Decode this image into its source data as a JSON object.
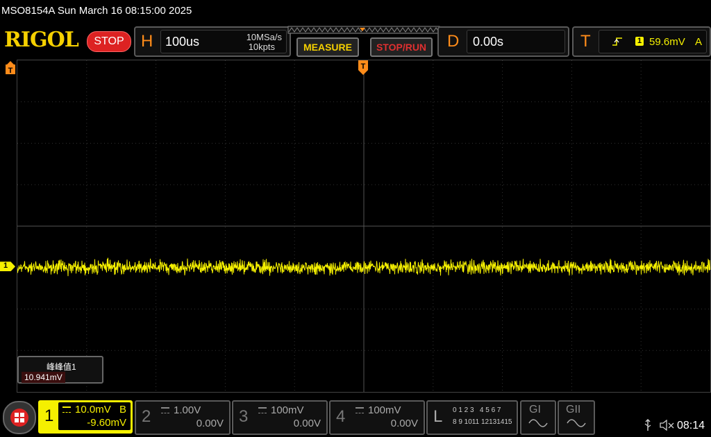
{
  "title_bar": {
    "text": "MSO8154A  Sun March 16 08:15:00 2025"
  },
  "header": {
    "logo": "RIGOL",
    "run_state": "STOP",
    "horizontal": {
      "letter": "H",
      "timebase": "100us",
      "sample_rate": "10MSa/s",
      "memory_depth": "10kpts"
    },
    "measure_label": "MEASURE",
    "stop_run_label": "STOP/RUN",
    "delay": {
      "letter": "D",
      "value": "0.00s"
    },
    "trigger": {
      "letter": "T",
      "source_badge": "1",
      "level": "59.6mV",
      "mode": "A"
    }
  },
  "colors": {
    "ch1": "#f5f000",
    "accent": "#ff8c1a",
    "stop": "#d22222"
  },
  "waveform": {
    "ch1_marker": "1",
    "level_fraction": 0.624,
    "noise_fraction": 0.03
  },
  "measurement": {
    "label": "峰峰值1",
    "value": "10.941mV"
  },
  "channels": [
    {
      "num": "1",
      "scale": "10.0mV",
      "bw": "B",
      "offset": "-9.60mV",
      "active": true
    },
    {
      "num": "2",
      "scale": "1.00V",
      "offset": "0.00V",
      "active": false
    },
    {
      "num": "3",
      "scale": "100mV",
      "offset": "0.00V",
      "active": false
    },
    {
      "num": "4",
      "scale": "100mV",
      "offset": "0.00V",
      "active": false
    }
  ],
  "logic": {
    "letter": "L",
    "row1": "0 1 2 3   4 5 6 7",
    "row2": "8 9 1011 12131415"
  },
  "generators": {
    "g1": "GI",
    "g2": "GII"
  },
  "status": {
    "time": "08:14"
  }
}
